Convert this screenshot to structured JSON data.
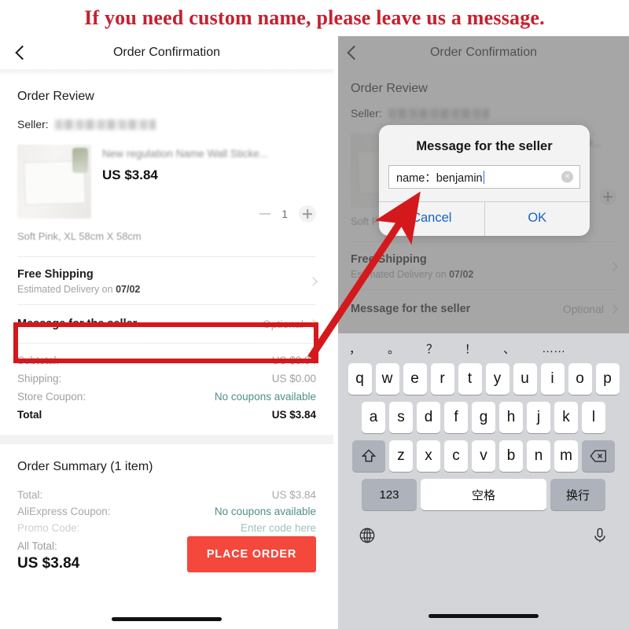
{
  "banner": {
    "text": "If you need custom name, please leave us a message."
  },
  "nav": {
    "title": "Order Confirmation",
    "back_icon": "chevron-left-icon"
  },
  "order_review": {
    "heading": "Order Review",
    "seller_label": "Seller:",
    "seller_name": "",
    "product": {
      "title": "New regulation Name Wall Sticke...",
      "price": "US $3.84",
      "quantity": "1",
      "variant": "Soft Pink, XL 58cm X 58cm"
    }
  },
  "shipping": {
    "title": "Free Shipping",
    "estimate_prefix": "Estimated Delivery on",
    "estimate_date": "07/02"
  },
  "message_row": {
    "label": "Message for the seller",
    "value": "Optional"
  },
  "totals": [
    {
      "key": "Subtotal:",
      "value": "US $3.84",
      "style": "normal"
    },
    {
      "key": "Shipping:",
      "value": "US $0.00",
      "style": "normal"
    },
    {
      "key": "Store Coupon:",
      "value": "No coupons available",
      "style": "teal"
    },
    {
      "key": "Total",
      "value": "US $3.84",
      "style": "bold"
    }
  ],
  "summary": {
    "heading": "Order Summary (1 item)",
    "lines": [
      {
        "key": "Total:",
        "value": "US $3.84",
        "style": "normal"
      },
      {
        "key": "AliExpress Coupon:",
        "value": "No coupons available",
        "style": "teal"
      },
      {
        "key": "Promo Code:",
        "value": "Enter code here",
        "style": "teal"
      }
    ],
    "all_total_label": "All Total:",
    "all_total_value": "US $3.84",
    "place_order_label": "PLACE ORDER"
  },
  "dialog": {
    "title": "Message for the seller",
    "input_value": "name：benjamin",
    "clear_icon": "clear-circle-icon",
    "cancel_label": "Cancel",
    "ok_label": "OK"
  },
  "keyboard": {
    "suggestions": [
      "，",
      "。",
      "？",
      "！",
      "、",
      "……"
    ],
    "row1": [
      "q",
      "w",
      "e",
      "r",
      "t",
      "y",
      "u",
      "i",
      "o",
      "p"
    ],
    "row2": [
      "a",
      "s",
      "d",
      "f",
      "g",
      "h",
      "j",
      "k",
      "l"
    ],
    "row3": [
      "z",
      "x",
      "c",
      "v",
      "b",
      "n",
      "m"
    ],
    "shift_icon": "shift-up-icon",
    "backspace_icon": "backspace-icon",
    "numeric_label": "123",
    "space_label": "空格",
    "return_label": "换行",
    "globe_icon": "globe-icon",
    "mic_icon": "microphone-icon"
  },
  "colors": {
    "banner_red": "#c4212f",
    "annotation_red": "#d4191c",
    "place_order_red": "#f4483c",
    "link_blue": "#1565c0",
    "coupon_teal": "#4e8f89"
  }
}
